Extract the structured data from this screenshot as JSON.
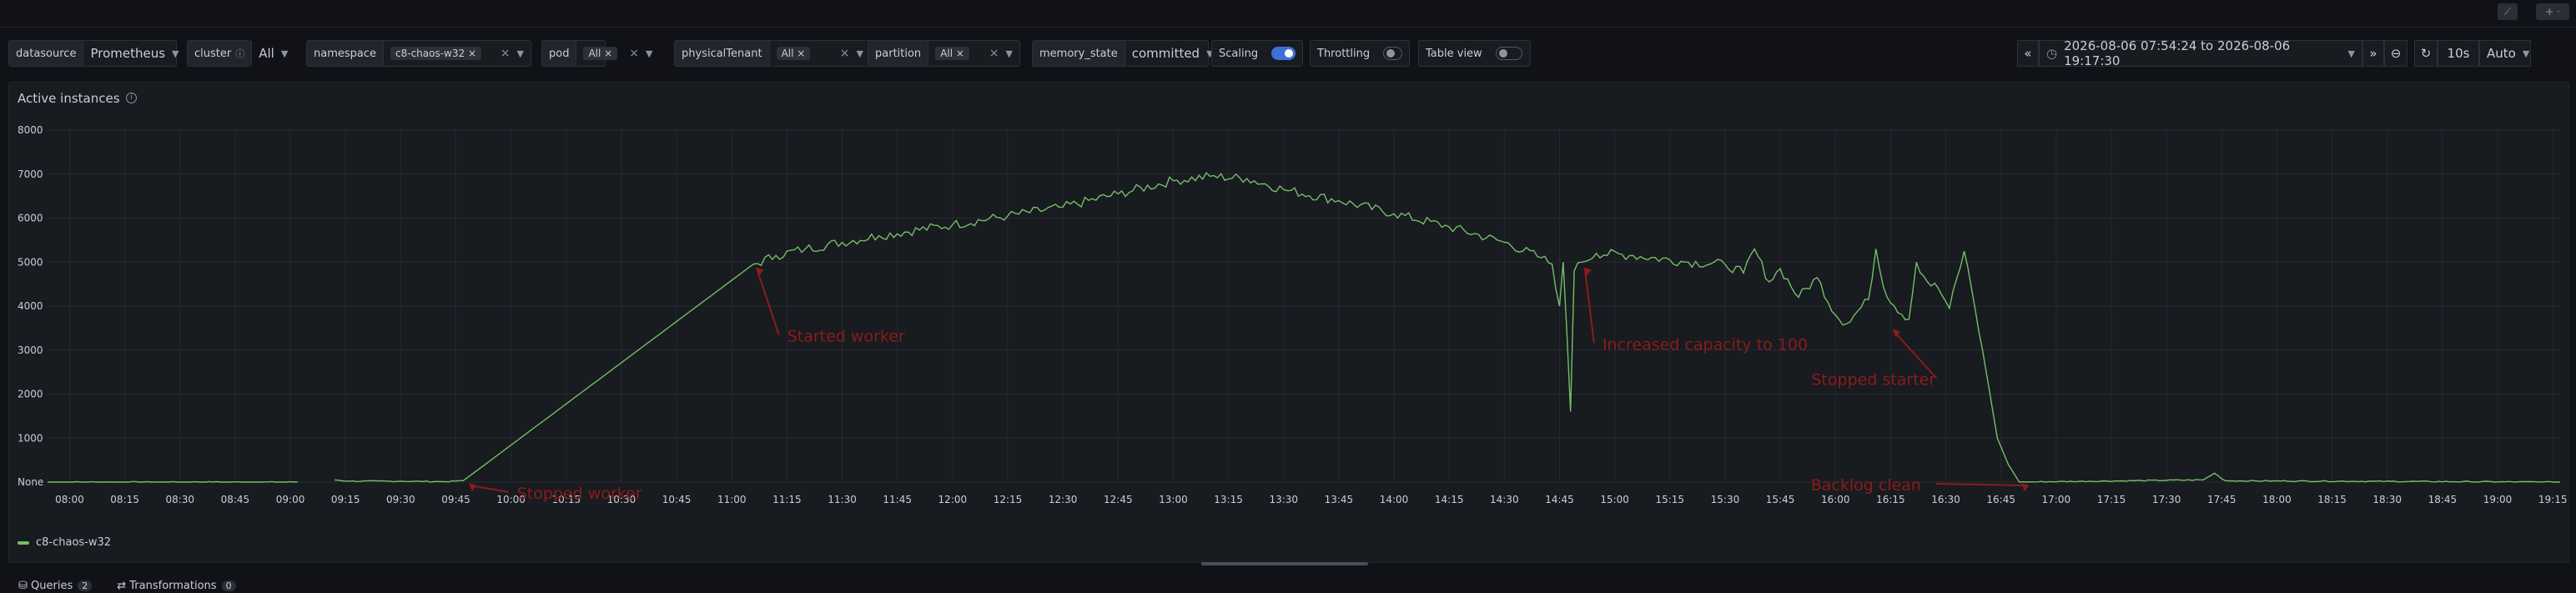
{
  "variables": [
    {
      "label": "datasource",
      "value": "Prometheus",
      "type": "select"
    },
    {
      "label": "cluster",
      "value": "All",
      "type": "select",
      "info": true
    },
    {
      "label": "namespace",
      "chips": [
        "c8-chaos-w32"
      ],
      "type": "multi"
    },
    {
      "label": "pod",
      "chips": [
        "All"
      ],
      "type": "multi"
    },
    {
      "label": "physicalTenant",
      "chips": [
        "All"
      ],
      "type": "multi"
    },
    {
      "label": "partition",
      "chips": [
        "All"
      ],
      "type": "multi"
    },
    {
      "label": "memory_state",
      "value": "committed",
      "type": "select"
    },
    {
      "label": "Scaling",
      "toggle": true
    },
    {
      "label": "Throttling",
      "toggle": false
    },
    {
      "label": "Table view",
      "toggle": false
    }
  ],
  "time_range": {
    "text": "2026-08-06 07:54:24 to 2026-08-06 19:17:30",
    "refresh": "10s",
    "interval": "Auto"
  },
  "panel": {
    "title": "Active instances"
  },
  "tabs": [
    {
      "label": "Queries",
      "count": "2"
    },
    {
      "label": "Transformations",
      "count": "0"
    }
  ],
  "chart_data": {
    "type": "line",
    "title": "Active instances",
    "y_ticks": [
      "None",
      "1000",
      "2000",
      "3000",
      "4000",
      "5000",
      "6000",
      "7000",
      "8000"
    ],
    "ylim": [
      0,
      8000
    ],
    "x_ticks": [
      "08:00",
      "08:15",
      "08:30",
      "08:45",
      "09:00",
      "09:15",
      "09:30",
      "09:45",
      "10:00",
      "10:15",
      "10:30",
      "10:45",
      "11:00",
      "11:15",
      "11:30",
      "11:45",
      "12:00",
      "12:15",
      "12:30",
      "12:45",
      "13:00",
      "13:15",
      "13:30",
      "13:45",
      "14:00",
      "14:15",
      "14:30",
      "14:45",
      "15:00",
      "15:15",
      "15:30",
      "15:45",
      "16:00",
      "16:15",
      "16:30",
      "16:45",
      "17:00",
      "17:15",
      "17:30",
      "17:45",
      "18:00",
      "18:15",
      "18:30",
      "18:45",
      "19:00",
      "19:15"
    ],
    "x_range": [
      "07:54",
      "19:17"
    ],
    "grid": true,
    "legend_position": "bottom-left",
    "series": [
      {
        "name": "c8-chaos-w32",
        "color": "#73bf69",
        "points": [
          [
            "07:54",
            0
          ],
          [
            "09:02",
            0
          ],
          [
            "09:12",
            50
          ],
          [
            "09:16",
            20
          ],
          [
            "09:30",
            20
          ],
          [
            "09:42",
            10
          ],
          [
            "09:47",
            30
          ],
          [
            "11:05",
            4900
          ],
          [
            "11:12",
            5150
          ],
          [
            "11:20",
            5300
          ],
          [
            "11:40",
            5600
          ],
          [
            "12:00",
            5850
          ],
          [
            "12:15",
            6050
          ],
          [
            "12:30",
            6250
          ],
          [
            "12:45",
            6550
          ],
          [
            "13:00",
            6850
          ],
          [
            "13:10",
            6950
          ],
          [
            "13:20",
            6900
          ],
          [
            "13:30",
            6650
          ],
          [
            "13:45",
            6400
          ],
          [
            "14:00",
            6100
          ],
          [
            "14:15",
            5800
          ],
          [
            "14:30",
            5450
          ],
          [
            "14:40",
            5100
          ],
          [
            "14:43",
            4950
          ],
          [
            "14:45",
            4000
          ],
          [
            "14:46",
            5000
          ],
          [
            "14:47",
            3400
          ],
          [
            "14:48",
            1600
          ],
          [
            "14:49",
            4800
          ],
          [
            "14:51",
            5000
          ],
          [
            "14:55",
            5200
          ],
          [
            "15:05",
            5150
          ],
          [
            "15:20",
            5000
          ],
          [
            "15:30",
            4950
          ],
          [
            "15:35",
            4750
          ],
          [
            "15:38",
            5300
          ],
          [
            "15:42",
            4550
          ],
          [
            "15:45",
            4850
          ],
          [
            "15:50",
            4200
          ],
          [
            "15:55",
            4650
          ],
          [
            "16:00",
            3800
          ],
          [
            "16:03",
            3600
          ],
          [
            "16:09",
            4150
          ],
          [
            "16:11",
            5300
          ],
          [
            "16:13",
            4450
          ],
          [
            "16:16",
            4000
          ],
          [
            "16:20",
            3700
          ],
          [
            "16:22",
            5000
          ],
          [
            "16:25",
            4550
          ],
          [
            "16:28",
            4400
          ],
          [
            "16:31",
            3950
          ],
          [
            "16:35",
            5250
          ],
          [
            "16:37",
            4400
          ],
          [
            "16:40",
            3000
          ],
          [
            "16:42",
            2000
          ],
          [
            "16:44",
            1000
          ],
          [
            "16:47",
            400
          ],
          [
            "16:50",
            0
          ],
          [
            "17:40",
            50
          ],
          [
            "17:43",
            200
          ],
          [
            "17:46",
            30
          ],
          [
            "19:17",
            0
          ]
        ]
      }
    ],
    "annotations": [
      {
        "text": "Stopped worker",
        "x": "09:48",
        "y": 0
      },
      {
        "text": "Started worker",
        "x": "11:06",
        "y": 4900
      },
      {
        "text": "Increased capacity to 100",
        "x": "14:51",
        "y": 4900
      },
      {
        "text": "Stopped starter",
        "x": "16:15",
        "y": 3500
      },
      {
        "text": "Backlog clean",
        "x": "16:50",
        "y": 0
      }
    ]
  }
}
